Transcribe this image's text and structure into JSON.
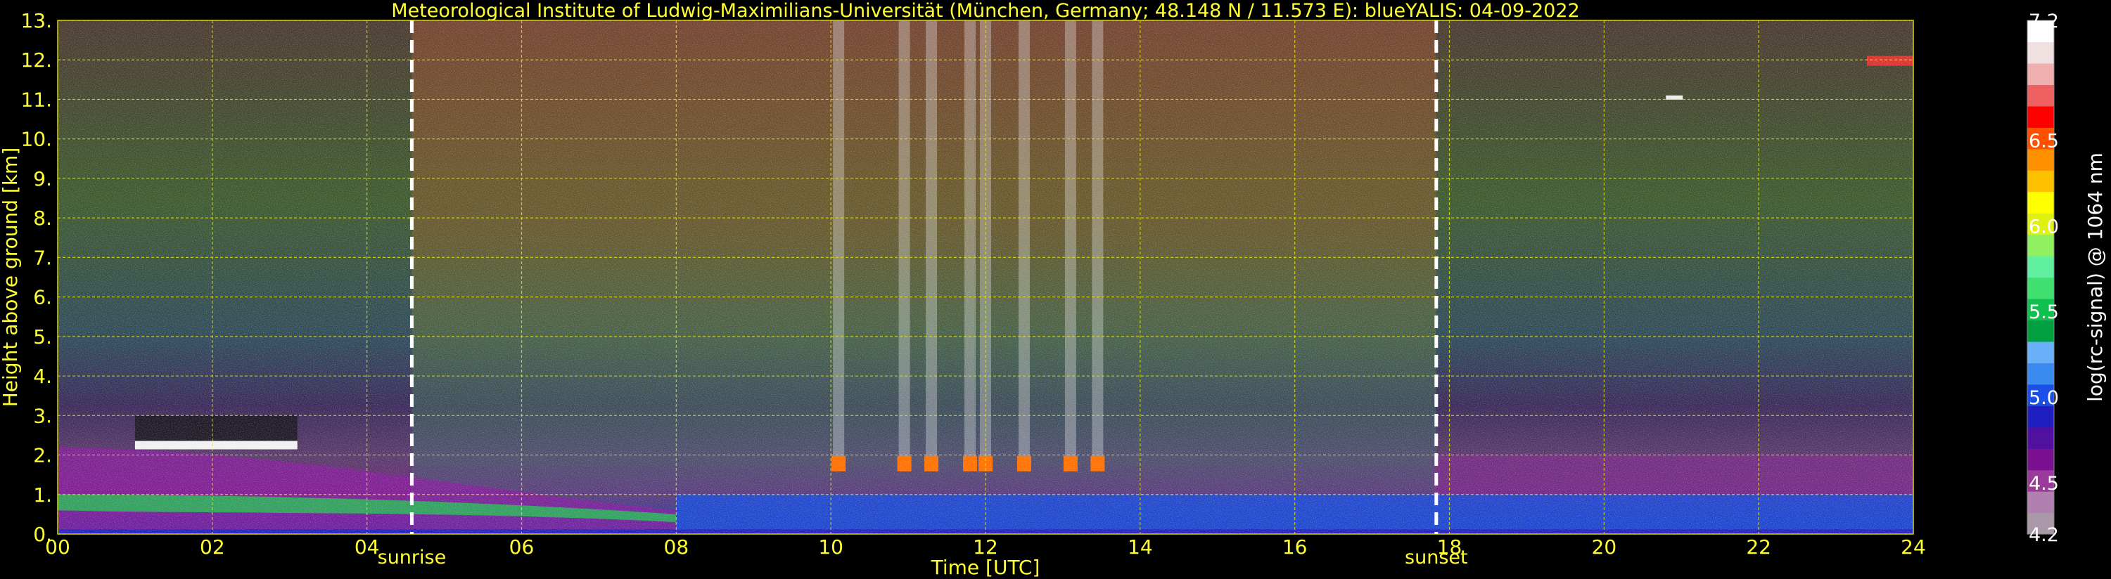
{
  "chart_data": {
    "type": "heatmap",
    "title": "Meteorological Institute of Ludwig-Maximilians-Universität (München, Germany; 48.148 N / 11.573 E):     blueYALIS: 04-09-2022",
    "xlabel": "Time [UTC]",
    "ylabel": "Height above ground [km]",
    "xlim": [
      0,
      24
    ],
    "ylim": [
      0,
      13
    ],
    "x_ticks": [
      "00",
      "02",
      "04",
      "06",
      "08",
      "10",
      "12",
      "14",
      "16",
      "18",
      "20",
      "22",
      "24"
    ],
    "y_ticks": [
      "0.",
      "1.",
      "2.",
      "3.",
      "4.",
      "5.",
      "6.",
      "7.",
      "8.",
      "9.",
      "10.",
      "11.",
      "12.",
      "13."
    ],
    "grid": true,
    "markers": [
      {
        "label": "sunrise",
        "time": 4.58
      },
      {
        "label": "sunset",
        "time": 17.83
      }
    ],
    "colorbar": {
      "label": "log(rc-signal) @ 1064 nm",
      "range": [
        4.2,
        7.2
      ],
      "tick_labels": [
        "4.2",
        "4.5",
        "5.0",
        "5.5",
        "6.0",
        "6.5",
        "7.2"
      ],
      "tick_values": [
        4.2,
        4.5,
        5.0,
        5.5,
        6.0,
        6.5,
        7.2
      ],
      "colors": [
        "#a898a8",
        "#b080b0",
        "#9a3a9a",
        "#7a1090",
        "#5010a0",
        "#2020c0",
        "#1a50e8",
        "#3a8af0",
        "#6ab0f8",
        "#00a040",
        "#10c050",
        "#40e070",
        "#60f0a0",
        "#90f060",
        "#e0f010",
        "#ffff00",
        "#ffc000",
        "#ff9000",
        "#ff5000",
        "#ff0000",
        "#f06060",
        "#f0b0b0",
        "#f0e0e0",
        "#ffffff"
      ]
    },
    "features": [
      {
        "name": "cloud-layer",
        "start": 1.0,
        "end": 3.1,
        "height_km": 2.25
      },
      {
        "name": "cloud-cluster",
        "start": 10.0,
        "end": 13.6,
        "height_km": 1.8
      },
      {
        "name": "cirrus",
        "start": 20.8,
        "end": 24.0,
        "height_km": 11.5
      },
      {
        "name": "residual-layer-top",
        "start": 0.0,
        "end": 8.5,
        "height_km": 1.0
      }
    ]
  }
}
